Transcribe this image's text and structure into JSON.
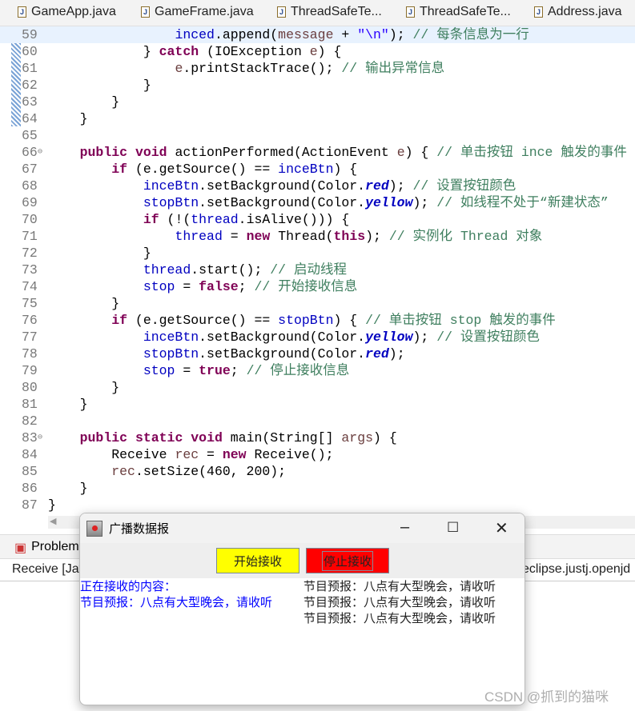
{
  "tabs": [
    "GameApp.java",
    "GameFrame.java",
    "ThreadSafeTe...",
    "ThreadSafeTe...",
    "Address.java"
  ],
  "code": [
    {
      "n": "59",
      "t": [
        [
          "                ",
          "p"
        ],
        [
          "inced",
          "f"
        ],
        [
          ".append(",
          "p"
        ],
        [
          "message",
          "v"
        ],
        [
          " + ",
          "p"
        ],
        [
          "\"\\n\"",
          "s"
        ],
        [
          "); ",
          "p"
        ],
        [
          "// 每条信息为一行",
          "c"
        ]
      ]
    },
    {
      "n": "60",
      "t": [
        [
          "            } ",
          "p"
        ],
        [
          "catch",
          "k"
        ],
        [
          " (IOException ",
          "p"
        ],
        [
          "e",
          "v"
        ],
        [
          ") {",
          "p"
        ]
      ]
    },
    {
      "n": "61",
      "t": [
        [
          "                ",
          "p"
        ],
        [
          "e",
          "v"
        ],
        [
          ".printStackTrace(); ",
          "p"
        ],
        [
          "// 输出异常信息",
          "c"
        ]
      ]
    },
    {
      "n": "62",
      "t": [
        [
          "            }",
          "p"
        ]
      ]
    },
    {
      "n": "63",
      "t": [
        [
          "        }",
          "p"
        ]
      ]
    },
    {
      "n": "64",
      "t": [
        [
          "    }",
          "p"
        ]
      ]
    },
    {
      "n": "65",
      "t": []
    },
    {
      "n": "66",
      "t": [
        [
          "    ",
          "p"
        ],
        [
          "public",
          "k"
        ],
        [
          " ",
          "p"
        ],
        [
          "void",
          "k"
        ],
        [
          " actionPerformed(ActionEvent ",
          "p"
        ],
        [
          "e",
          "v"
        ],
        [
          ") { ",
          "p"
        ],
        [
          "// 单击按钮 ince 触发的事件",
          "c"
        ]
      ]
    },
    {
      "n": "67",
      "t": [
        [
          "        ",
          "p"
        ],
        [
          "if",
          "k"
        ],
        [
          " (e.getSource() == ",
          "p"
        ],
        [
          "inceBtn",
          "f"
        ],
        [
          ") {",
          "p"
        ]
      ]
    },
    {
      "n": "68",
      "t": [
        [
          "            ",
          "p"
        ],
        [
          "inceBtn",
          "f"
        ],
        [
          ".setBackground(Color.",
          "p"
        ],
        [
          "red",
          "st"
        ],
        [
          "); ",
          "p"
        ],
        [
          "// 设置按钮颜色",
          "c"
        ]
      ]
    },
    {
      "n": "69",
      "t": [
        [
          "            ",
          "p"
        ],
        [
          "stopBtn",
          "f"
        ],
        [
          ".setBackground(Color.",
          "p"
        ],
        [
          "yellow",
          "st"
        ],
        [
          "); ",
          "p"
        ],
        [
          "// 如线程不处于“新建状态”",
          "c"
        ]
      ]
    },
    {
      "n": "70",
      "t": [
        [
          "            ",
          "p"
        ],
        [
          "if",
          "k"
        ],
        [
          " (!(",
          "p"
        ],
        [
          "thread",
          "f"
        ],
        [
          ".isAlive())) {",
          "p"
        ]
      ]
    },
    {
      "n": "71",
      "t": [
        [
          "                ",
          "p"
        ],
        [
          "thread",
          "f"
        ],
        [
          " = ",
          "p"
        ],
        [
          "new",
          "k"
        ],
        [
          " Thread(",
          "p"
        ],
        [
          "this",
          "k"
        ],
        [
          "); ",
          "p"
        ],
        [
          "// 实例化 Thread 对象",
          "c"
        ]
      ]
    },
    {
      "n": "72",
      "t": [
        [
          "            }",
          "p"
        ]
      ]
    },
    {
      "n": "73",
      "t": [
        [
          "            ",
          "p"
        ],
        [
          "thread",
          "f"
        ],
        [
          ".start(); ",
          "p"
        ],
        [
          "// 启动线程",
          "c"
        ]
      ]
    },
    {
      "n": "74",
      "t": [
        [
          "            ",
          "p"
        ],
        [
          "stop",
          "f"
        ],
        [
          " = ",
          "p"
        ],
        [
          "false",
          "k"
        ],
        [
          "; ",
          "p"
        ],
        [
          "// 开始接收信息",
          "c"
        ]
      ]
    },
    {
      "n": "75",
      "t": [
        [
          "        }",
          "p"
        ]
      ]
    },
    {
      "n": "76",
      "t": [
        [
          "        ",
          "p"
        ],
        [
          "if",
          "k"
        ],
        [
          " (e.getSource() == ",
          "p"
        ],
        [
          "stopBtn",
          "f"
        ],
        [
          ") { ",
          "p"
        ],
        [
          "// 单击按钮 stop 触发的事件",
          "c"
        ]
      ]
    },
    {
      "n": "77",
      "t": [
        [
          "            ",
          "p"
        ],
        [
          "inceBtn",
          "f"
        ],
        [
          ".setBackground(Color.",
          "p"
        ],
        [
          "yellow",
          "st"
        ],
        [
          "); ",
          "p"
        ],
        [
          "// 设置按钮颜色",
          "c"
        ]
      ]
    },
    {
      "n": "78",
      "t": [
        [
          "            ",
          "p"
        ],
        [
          "stopBtn",
          "f"
        ],
        [
          ".setBackground(Color.",
          "p"
        ],
        [
          "red",
          "st"
        ],
        [
          ");",
          "p"
        ]
      ]
    },
    {
      "n": "79",
      "t": [
        [
          "            ",
          "p"
        ],
        [
          "stop",
          "f"
        ],
        [
          " = ",
          "p"
        ],
        [
          "true",
          "k"
        ],
        [
          "; ",
          "p"
        ],
        [
          "// 停止接收信息",
          "c"
        ]
      ]
    },
    {
      "n": "80",
      "t": [
        [
          "        }",
          "p"
        ]
      ]
    },
    {
      "n": "81",
      "t": [
        [
          "    }",
          "p"
        ]
      ]
    },
    {
      "n": "82",
      "t": []
    },
    {
      "n": "83",
      "t": [
        [
          "    ",
          "p"
        ],
        [
          "public",
          "k"
        ],
        [
          " ",
          "p"
        ],
        [
          "static",
          "k"
        ],
        [
          " ",
          "p"
        ],
        [
          "void",
          "k"
        ],
        [
          " main(String[] ",
          "p"
        ],
        [
          "args",
          "v"
        ],
        [
          ") {",
          "p"
        ]
      ]
    },
    {
      "n": "84",
      "t": [
        [
          "        Receive ",
          "p"
        ],
        [
          "rec",
          "v"
        ],
        [
          " = ",
          "p"
        ],
        [
          "new",
          "k"
        ],
        [
          " Receive();",
          "p"
        ]
      ]
    },
    {
      "n": "85",
      "t": [
        [
          "        ",
          "p"
        ],
        [
          "rec",
          "v"
        ],
        [
          ".setSize(460, 200);",
          "p"
        ]
      ]
    },
    {
      "n": "86",
      "t": [
        [
          "    }",
          "p"
        ]
      ]
    },
    {
      "n": "87",
      "t": [
        [
          "}",
          "p"
        ]
      ]
    }
  ],
  "bottom": {
    "tab": "Problem",
    "console_title": "Receive [Jav",
    "console_right": "eclipse.justj.openjd"
  },
  "dialog": {
    "title": "广播数据报",
    "start_label": "开始接收",
    "stop_label": "停止接收",
    "left_lines": [
      "正在接收的内容：",
      "节目预报：八点有大型晚会，请收听"
    ],
    "right_lines": [
      "节目预报：八点有大型晚会，请收听",
      "节目预报：八点有大型晚会，请收听",
      "节目预报：八点有大型晚会，请收听"
    ],
    "start_color": "#ffff00",
    "stop_color": "#ff0000"
  },
  "watermark": "CSDN @抓到的猫咪"
}
